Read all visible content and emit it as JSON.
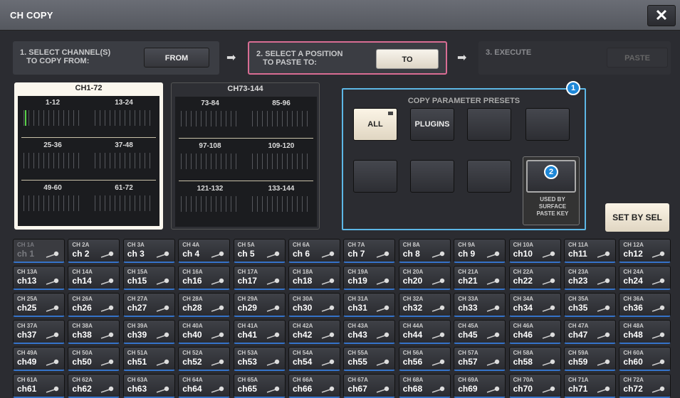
{
  "window": {
    "title": "CH COPY",
    "close_label": "✕"
  },
  "steps": {
    "step1": {
      "text": "1. SELECT CHANNEL(S)\n   TO COPY FROM:",
      "button": "FROM"
    },
    "step2": {
      "text": "2. SELECT A POSITION\n   TO PASTE TO:",
      "button": "TO"
    },
    "step3": {
      "text": "3. EXECUTE",
      "button": "PASTE"
    },
    "arrow": "➡"
  },
  "banks": [
    {
      "label": "CH1-72",
      "groups": [
        "1-12",
        "13-24",
        "25-36",
        "37-48",
        "49-60",
        "61-72"
      ],
      "selected": true
    },
    {
      "label": "CH73-144",
      "groups": [
        "73-84",
        "85-96",
        "97-108",
        "109-120",
        "121-132",
        "133-144"
      ],
      "selected": false
    }
  ],
  "presets": {
    "title": "COPY PARAMETER PRESETS",
    "buttons": [
      "ALL",
      "PLUGINS",
      "",
      "",
      "",
      "",
      "",
      ""
    ],
    "badge1": "1",
    "badge2": "2",
    "used_by": "USED BY\nSURFACE\nPASTE KEY"
  },
  "set_by_sel": "SET BY SEL",
  "channels": [
    {
      "n": "CH 1A",
      "l": "ch 1"
    },
    {
      "n": "CH 2A",
      "l": "ch 2"
    },
    {
      "n": "CH 3A",
      "l": "ch 3"
    },
    {
      "n": "CH 4A",
      "l": "ch 4"
    },
    {
      "n": "CH 5A",
      "l": "ch 5"
    },
    {
      "n": "CH 6A",
      "l": "ch 6"
    },
    {
      "n": "CH 7A",
      "l": "ch 7"
    },
    {
      "n": "CH 8A",
      "l": "ch 8"
    },
    {
      "n": "CH 9A",
      "l": "ch 9"
    },
    {
      "n": "CH 10A",
      "l": "ch10"
    },
    {
      "n": "CH 11A",
      "l": "ch11"
    },
    {
      "n": "CH 12A",
      "l": "ch12"
    },
    {
      "n": "CH 13A",
      "l": "ch13"
    },
    {
      "n": "CH 14A",
      "l": "ch14"
    },
    {
      "n": "CH 15A",
      "l": "ch15"
    },
    {
      "n": "CH 16A",
      "l": "ch16"
    },
    {
      "n": "CH 17A",
      "l": "ch17"
    },
    {
      "n": "CH 18A",
      "l": "ch18"
    },
    {
      "n": "CH 19A",
      "l": "ch19"
    },
    {
      "n": "CH 20A",
      "l": "ch20"
    },
    {
      "n": "CH 21A",
      "l": "ch21"
    },
    {
      "n": "CH 22A",
      "l": "ch22"
    },
    {
      "n": "CH 23A",
      "l": "ch23"
    },
    {
      "n": "CH 24A",
      "l": "ch24"
    },
    {
      "n": "CH 25A",
      "l": "ch25"
    },
    {
      "n": "CH 26A",
      "l": "ch26"
    },
    {
      "n": "CH 27A",
      "l": "ch27"
    },
    {
      "n": "CH 28A",
      "l": "ch28"
    },
    {
      "n": "CH 29A",
      "l": "ch29"
    },
    {
      "n": "CH 30A",
      "l": "ch30"
    },
    {
      "n": "CH 31A",
      "l": "ch31"
    },
    {
      "n": "CH 32A",
      "l": "ch32"
    },
    {
      "n": "CH 33A",
      "l": "ch33"
    },
    {
      "n": "CH 34A",
      "l": "ch34"
    },
    {
      "n": "CH 35A",
      "l": "ch35"
    },
    {
      "n": "CH 36A",
      "l": "ch36"
    },
    {
      "n": "CH 37A",
      "l": "ch37"
    },
    {
      "n": "CH 38A",
      "l": "ch38"
    },
    {
      "n": "CH 39A",
      "l": "ch39"
    },
    {
      "n": "CH 40A",
      "l": "ch40"
    },
    {
      "n": "CH 41A",
      "l": "ch41"
    },
    {
      "n": "CH 42A",
      "l": "ch42"
    },
    {
      "n": "CH 43A",
      "l": "ch43"
    },
    {
      "n": "CH 44A",
      "l": "ch44"
    },
    {
      "n": "CH 45A",
      "l": "ch45"
    },
    {
      "n": "CH 46A",
      "l": "ch46"
    },
    {
      "n": "CH 47A",
      "l": "ch47"
    },
    {
      "n": "CH 48A",
      "l": "ch48"
    },
    {
      "n": "CH 49A",
      "l": "ch49"
    },
    {
      "n": "CH 50A",
      "l": "ch50"
    },
    {
      "n": "CH 51A",
      "l": "ch51"
    },
    {
      "n": "CH 52A",
      "l": "ch52"
    },
    {
      "n": "CH 53A",
      "l": "ch53"
    },
    {
      "n": "CH 54A",
      "l": "ch54"
    },
    {
      "n": "CH 55A",
      "l": "ch55"
    },
    {
      "n": "CH 56A",
      "l": "ch56"
    },
    {
      "n": "CH 57A",
      "l": "ch57"
    },
    {
      "n": "CH 58A",
      "l": "ch58"
    },
    {
      "n": "CH 59A",
      "l": "ch59"
    },
    {
      "n": "CH 60A",
      "l": "ch60"
    },
    {
      "n": "CH 61A",
      "l": "ch61"
    },
    {
      "n": "CH 62A",
      "l": "ch62"
    },
    {
      "n": "CH 63A",
      "l": "ch63"
    },
    {
      "n": "CH 64A",
      "l": "ch64"
    },
    {
      "n": "CH 65A",
      "l": "ch65"
    },
    {
      "n": "CH 66A",
      "l": "ch66"
    },
    {
      "n": "CH 67A",
      "l": "ch67"
    },
    {
      "n": "CH 68A",
      "l": "ch68"
    },
    {
      "n": "CH 69A",
      "l": "ch69"
    },
    {
      "n": "CH 70A",
      "l": "ch70"
    },
    {
      "n": "CH 71A",
      "l": "ch71"
    },
    {
      "n": "CH 72A",
      "l": "ch72"
    }
  ],
  "colors": {
    "accent_pink": "#d96d94",
    "accent_blue": "#5db7e6",
    "selected": "#fbf7ee"
  }
}
